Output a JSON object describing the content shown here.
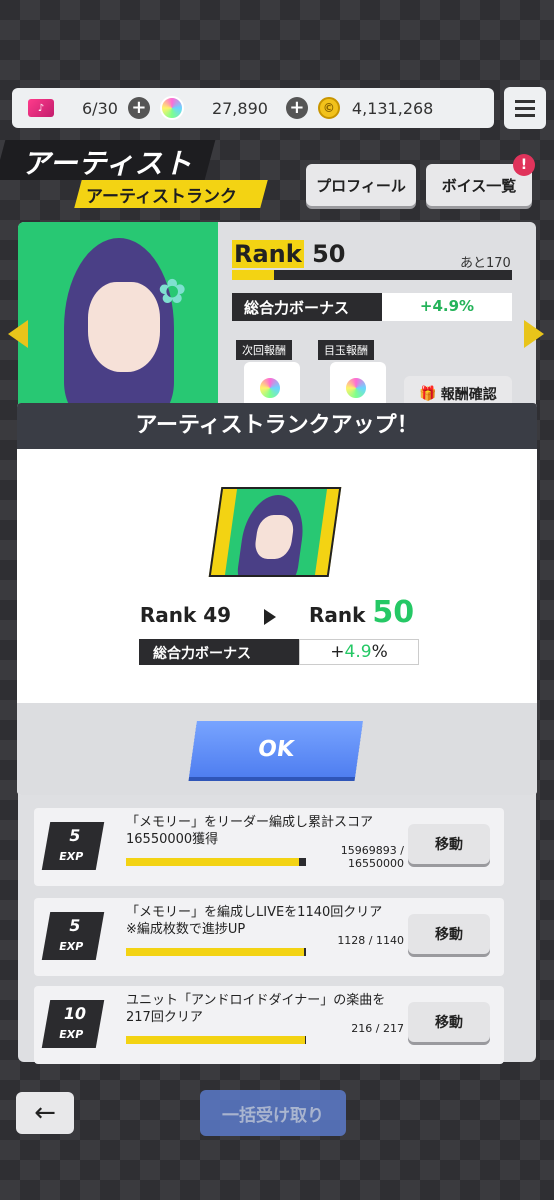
{
  "topbar": {
    "ticket_icon_label": "♪",
    "stamina": "6/30",
    "gems": "27,890",
    "coins": "4,131,268"
  },
  "header": {
    "title": "アーティスト",
    "subtitle": "アーティストランク",
    "profile_button": "プロフィール",
    "voice_button": "ボイス一覧",
    "badge": "!"
  },
  "rank_panel": {
    "rank_word": "Rank",
    "rank_value": "50",
    "remaining": "あと170",
    "bonus_label": "総合力ボーナス",
    "bonus_value": "+4.9%",
    "next_reward_tag": "次回報酬",
    "key_reward_tag": "目玉報酬",
    "confirm_rewards": "報酬確認",
    "progress_fraction": 0.15
  },
  "modal": {
    "title": "アーティストランクアップ！",
    "from_rank": "Rank 49",
    "to_rank_word": "Rank",
    "to_rank_value": "50",
    "bonus_label": "総合力ボーナス",
    "bonus_plus": "+",
    "bonus_number": "4.9",
    "bonus_percent": "%",
    "ok": "OK"
  },
  "missions": [
    {
      "exp_value": "5",
      "exp_unit": "EXP",
      "text": "「メモリー」をリーダー編成し累計スコア16550000獲得",
      "progress": "15969893 / 16550000",
      "progress_fraction": 0.96,
      "button": "移動"
    },
    {
      "exp_value": "5",
      "exp_unit": "EXP",
      "text": "「メモリー」を編成しLIVEを1140回クリア ※編成枚数で進捗UP",
      "progress": "1128 / 1140",
      "progress_fraction": 0.99,
      "button": "移動"
    },
    {
      "exp_value": "10",
      "exp_unit": "EXP",
      "text": "ユニット「アンドロイドダイナー」の楽曲を217回クリア",
      "progress": "216 / 217",
      "progress_fraction": 0.995,
      "button": "移動"
    }
  ],
  "footer": {
    "back_icon": "←",
    "collect_all": "一括受け取り"
  }
}
